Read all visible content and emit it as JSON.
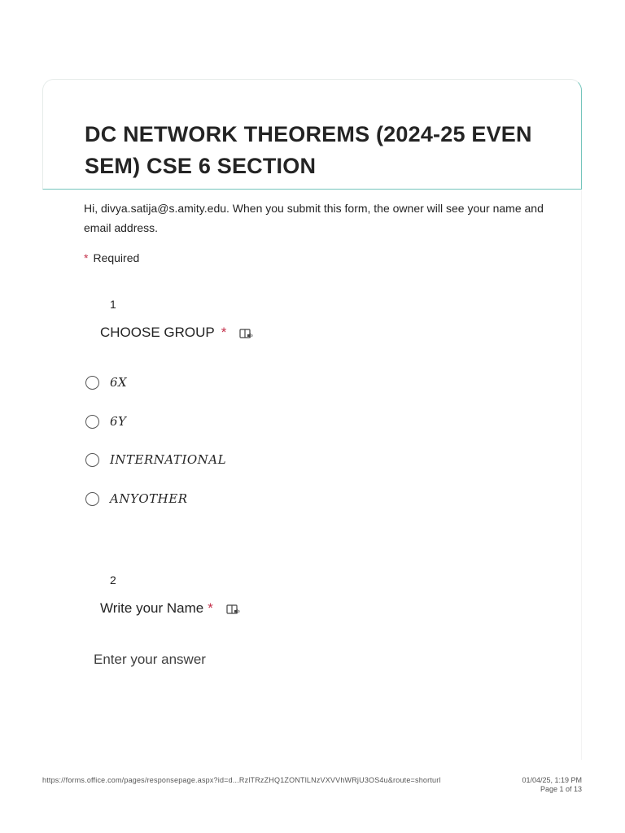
{
  "form": {
    "title": "DC NETWORK THEOREMS (2024-25 EVEN SEM) CSE 6 SECTION",
    "intro": "Hi, divya.satija@s.amity.edu. When you submit this form, the owner will see your name and email address.",
    "required_marker": "*",
    "required_label": "Required"
  },
  "questions": [
    {
      "number": "1",
      "title": "CHOOSE GROUP",
      "required": "*",
      "options": [
        "6X",
        "6Y",
        "INTERNATIONAL",
        "ANYOTHER"
      ]
    },
    {
      "number": "2",
      "title": "Write your Name",
      "required": "*",
      "placeholder": "Enter your answer"
    }
  ],
  "footer": {
    "url": "https://forms.office.com/pages/responsepage.aspx?id=d...RzlTRzZHQ1ZONTlLNzVXVVhWRjU3OS4u&route=shorturl",
    "datetime": "01/04/25, 1:19 PM",
    "page": "Page 1 of 13"
  },
  "colors": {
    "accent_border": "#74c5bc",
    "required_star": "#c4314b",
    "text": "#242424"
  },
  "icons": {
    "immersive_reader": "immersive-reader-icon",
    "radio": "radio-button"
  }
}
